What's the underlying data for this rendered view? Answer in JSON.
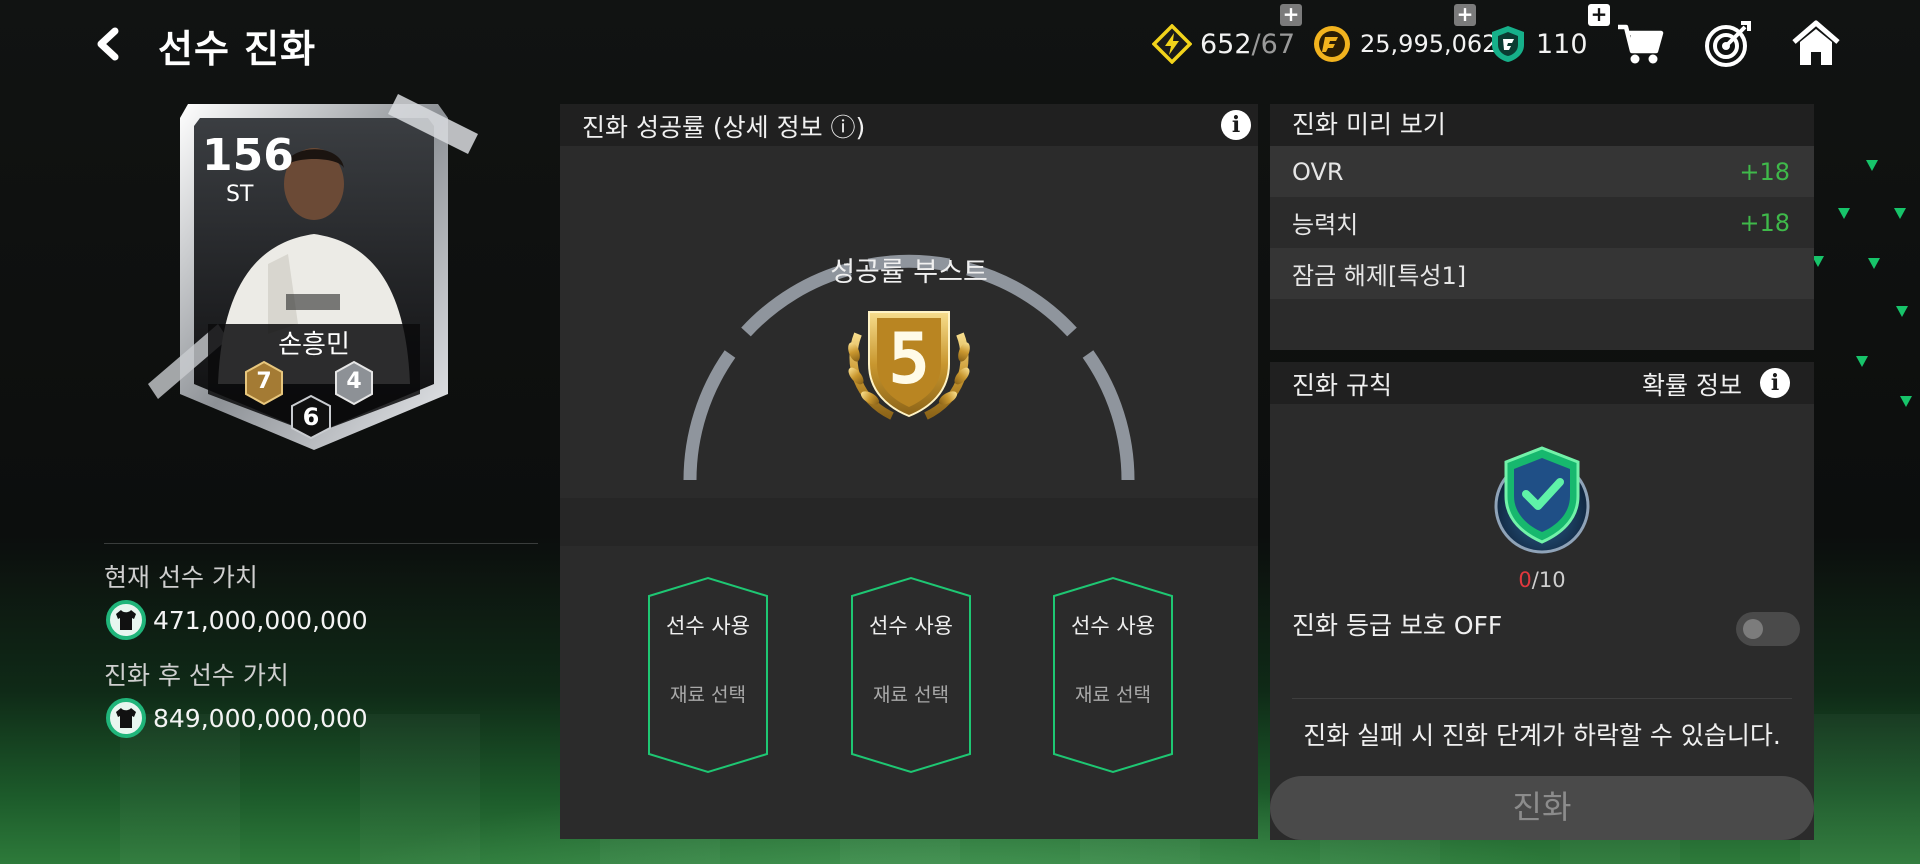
{
  "header": {
    "title": "선수 진화",
    "currencies": {
      "energy": {
        "current": "652",
        "separator": "/",
        "max": "67"
      },
      "fc_points": "25,995,062",
      "tokens": "110"
    }
  },
  "player_card": {
    "ovr": "156",
    "position": "ST",
    "name": "손흥민",
    "badge_left": "7",
    "badge_right": "4",
    "grade": "6",
    "card_color": "#c9ccd0"
  },
  "player_value": {
    "current_label": "현재 선수 가치",
    "current_value": "471,000,000,000",
    "after_label": "진화 후 선수 가치",
    "after_value": "849,000,000,000"
  },
  "success_panel": {
    "title": "진화 성공률 (상세 정보 ⓘ)",
    "boost_label": "성공률 부스트",
    "boost_level": "5",
    "slots": [
      {
        "line1": "선수 사용",
        "line2": "재료 선택"
      },
      {
        "line1": "선수 사용",
        "line2": "재료 선택"
      },
      {
        "line1": "선수 사용",
        "line2": "재료 선택"
      }
    ]
  },
  "preview": {
    "title": "진화 미리 보기",
    "rows": [
      {
        "label": "OVR",
        "value": "+18"
      },
      {
        "label": "능력치",
        "value": "+18"
      },
      {
        "label": "잠금 해제[특성1]",
        "value": ""
      }
    ]
  },
  "rules": {
    "title": "진화 규칙",
    "probability_label": "확률 정보",
    "protect_current": "0",
    "protect_max": "/10",
    "protect_label": "진화 등급 보호 OFF",
    "protect_enabled": false,
    "warning": "진화 실패 시 진화 단계가 하락할 수 있습니다."
  },
  "evolve_button": "진화",
  "colors": {
    "accent_green": "#3fb94a",
    "slot_border": "#1ec773",
    "counter_red": "#e0383e",
    "panel_bg": "#2b2b2b",
    "header_bg": "#202020"
  }
}
